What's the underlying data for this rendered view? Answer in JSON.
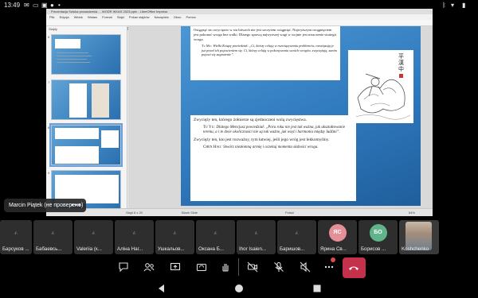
{
  "status_bar": {
    "time": "13:49",
    "icons": [
      "mail-icon",
      "cast-icon",
      "image-icon",
      "microphone-icon",
      "dot-icon",
      "bluetooth-icon",
      "wifi-icon",
      "battery-icon"
    ]
  },
  "libreoffice": {
    "window_title": "Prezentacja Sztuka prowadzenia ... WODR IKKAS 2023.pptx - LibreOffice Impress",
    "menu": [
      "Plik",
      "Edycja",
      "Widok",
      "Wstaw",
      "Format",
      "Slajd",
      "Pokaz slajdów",
      "Narzędzia",
      "Okno",
      "Pomoc"
    ],
    "slides_panel_label": "Slajdy",
    "thumbnails": [
      "6",
      "7",
      "8",
      "9"
    ],
    "slide": {
      "para1": "Osiągnąć sto zwycięstw w stu bitwach nie jest szczytem osiągnięć. Naj­wyższym osiągnięciem jest pokonać wroga bez walki. Dlatego sprawą najwyższej wagi w wojnie jest niszczenie strategii wroga.",
      "quote1_name": "Tu Mu",
      "quote1_text": ": Wielki Książę powiedział: „Ci, którzy celują w rozwiązy­waniu problemów, rozwiązują je już przed ich pojawieniem się. Ci, którzy celują w pokonywaniu swoich wrogów, zwyciężają, zanim pojawi się zagrożenie”.",
      "heading2": "Zwycięży ten, którego żołnierze są zjednoczeni wolą zwycięstwa.",
      "quote2_name": "Tu Yu",
      "quote2_text": ": Dlatego Mencjusz powiedział: „Pora roku nie jest tak ważna, jak ukształtowanie terenu, a i te dwie okoliczności nie są tak ważne, jak więź i harmonia między ludźmi”.",
      "heading3": "Zwycięży ten, kto jest rozważny, tym łatwiej, jeśli jego wróg jest lek­komyślny.",
      "quote3_name": "Chen Hao",
      "quote3_text": ": Stwórz niezłomną armię i oczekuj momentu sła­bości wroga.",
      "calligraphy": "平 漢 中"
    },
    "statusbar": {
      "slide_info": "Slajd 8 z 20",
      "layout": "Blank Slide",
      "language": "Polski",
      "zoom": "64%"
    }
  },
  "presenter": {
    "name": "Marcin Piątek (не проверено)",
    "more": "•••"
  },
  "participants": [
    {
      "name": "Барсуков ...",
      "type": "muted"
    },
    {
      "name": "Бабаевсь...",
      "type": "muted"
    },
    {
      "name": "Valeriia (к...",
      "type": "muted"
    },
    {
      "name": "Аліна Наг...",
      "type": "muted"
    },
    {
      "name": "Ушкальов...",
      "type": "muted"
    },
    {
      "name": "Оксана Б...",
      "type": "muted"
    },
    {
      "name": "Ihor Isaien...",
      "type": "muted"
    },
    {
      "name": "Баришов...",
      "type": "muted"
    },
    {
      "name": "Ярина Св...",
      "type": "avatar",
      "initials": "ЯС",
      "color": "#e58f96"
    },
    {
      "name": "Борисов ...",
      "type": "avatar",
      "initials": "БО",
      "color": "#5fb48c"
    },
    {
      "name": "Koshchenko",
      "type": "photo"
    }
  ],
  "controls": [
    "chat-icon",
    "participants-icon",
    "share-screen-icon",
    "camera-flip-icon",
    "raise-hand-icon",
    "camera-off-icon",
    "mic-off-icon",
    "speaker-off-icon",
    "more-icon",
    "hangup-icon"
  ],
  "colors": {
    "hangup": "#c4314b",
    "slide_blue": "#2f79bd",
    "avatar_pink": "#e58f96",
    "avatar_green": "#5fb48c"
  }
}
